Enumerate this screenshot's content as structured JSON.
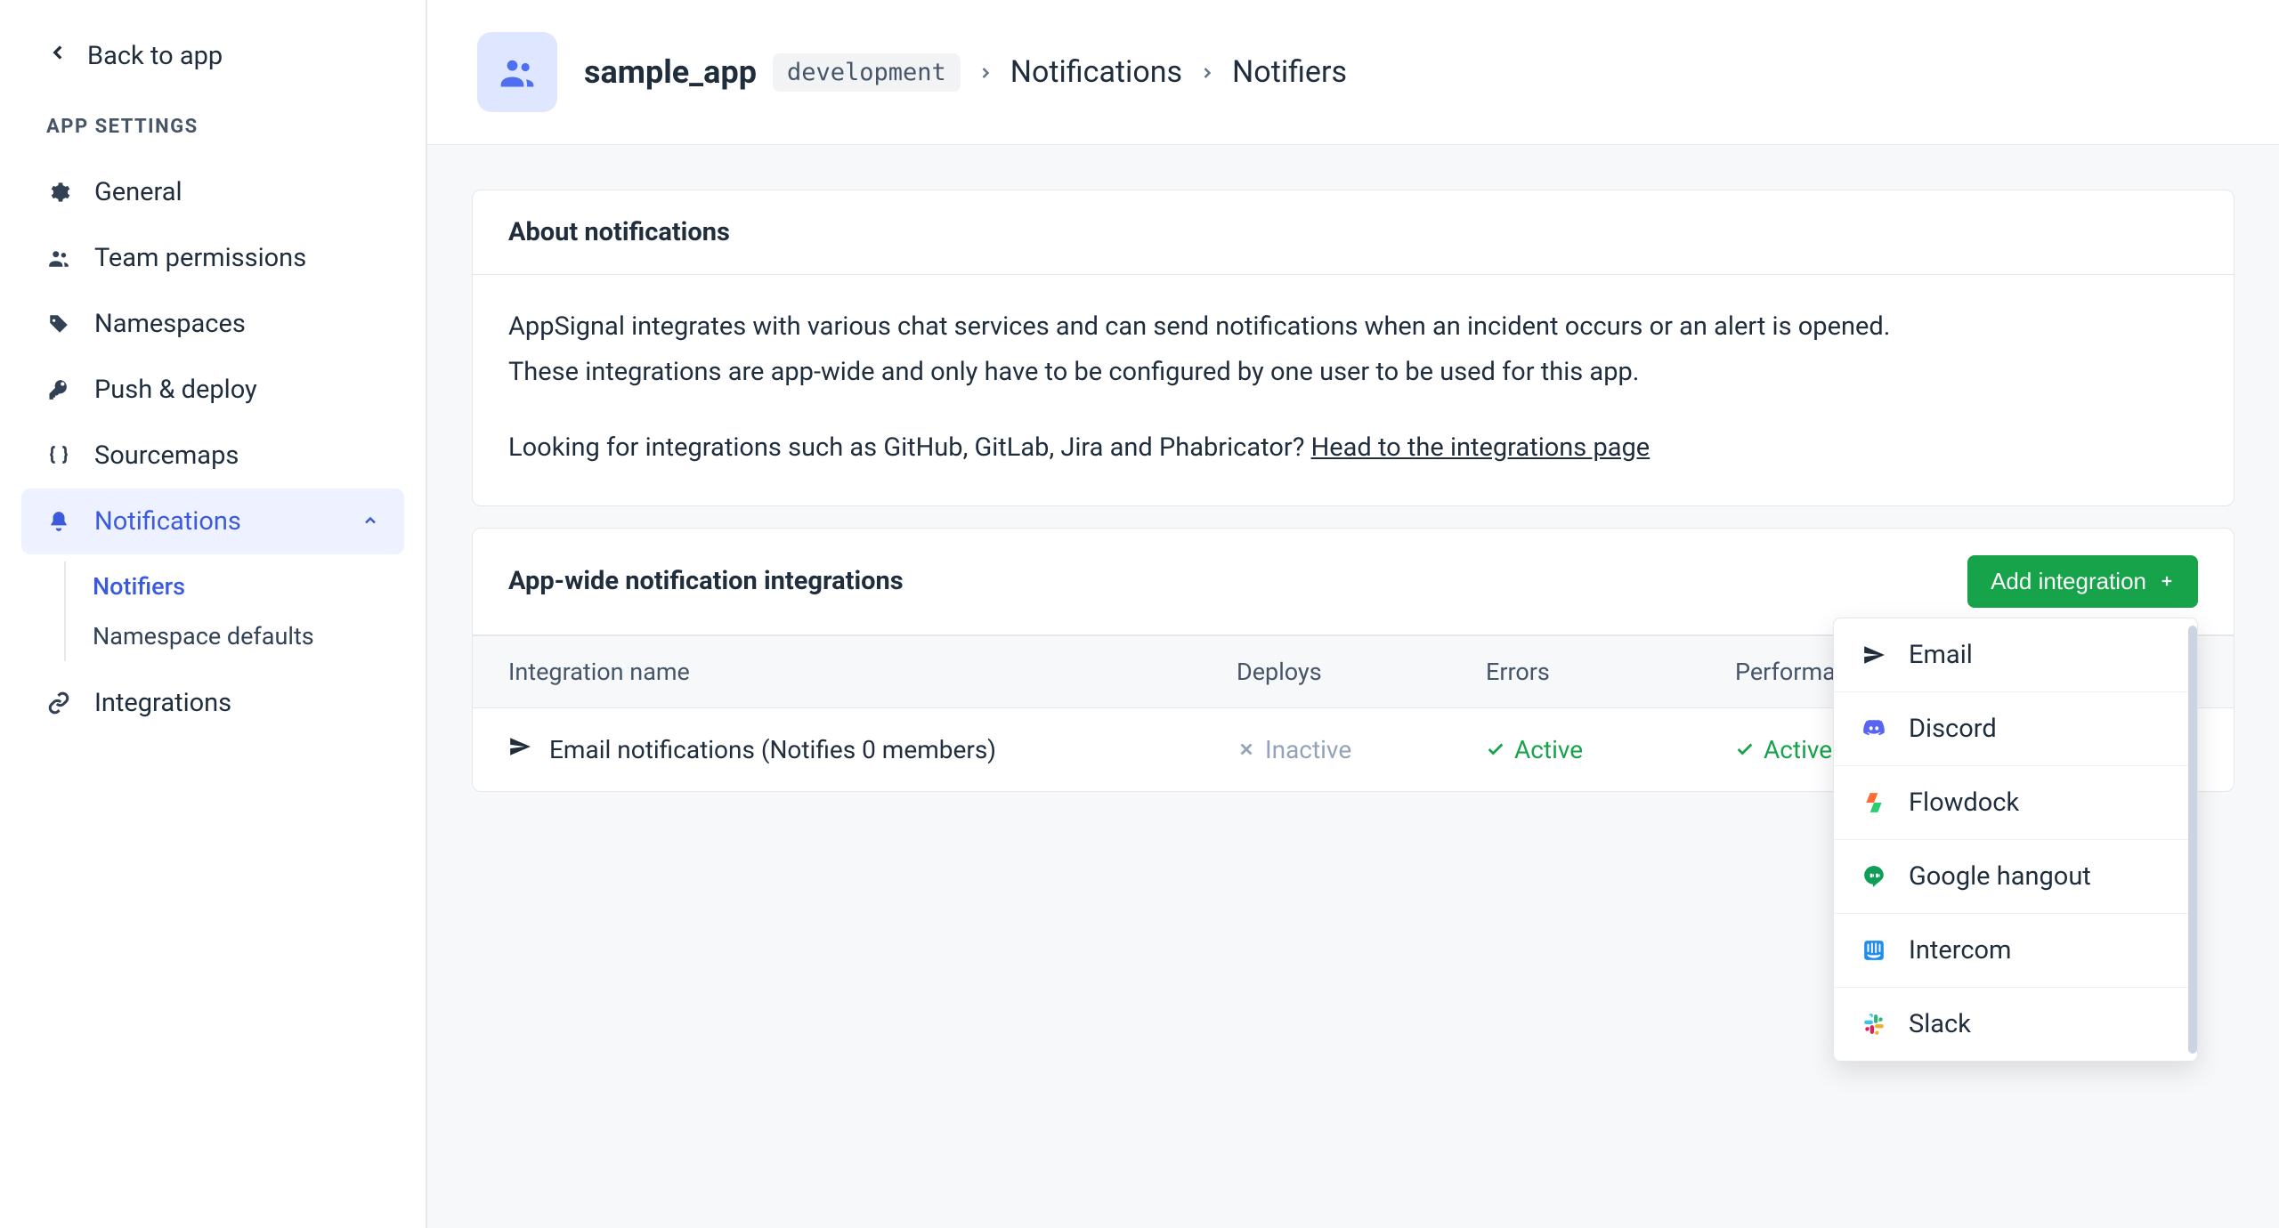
{
  "sidebar": {
    "back_label": "Back to app",
    "section_label": "APP SETTINGS",
    "items": [
      {
        "icon": "gear",
        "label": "General"
      },
      {
        "icon": "users",
        "label": "Team permissions"
      },
      {
        "icon": "tag",
        "label": "Namespaces"
      },
      {
        "icon": "key",
        "label": "Push & deploy"
      },
      {
        "icon": "braces",
        "label": "Sourcemaps"
      },
      {
        "icon": "bell",
        "label": "Notifications",
        "active": true
      },
      {
        "icon": "link",
        "label": "Integrations"
      }
    ],
    "sub_items": [
      {
        "label": "Notifiers",
        "selected": true
      },
      {
        "label": "Namespace defaults"
      }
    ]
  },
  "header": {
    "app_name": "sample_app",
    "env": "development",
    "crumbs": [
      "Notifications",
      "Notifiers"
    ]
  },
  "about": {
    "title": "About notifications",
    "line1": "AppSignal integrates with various chat services and can send notifications when an incident occurs or an alert is opened.",
    "line2": "These integrations are app-wide and only have to be configured by one user to be used for this app.",
    "line3_prefix": "Looking for integrations such as GitHub, GitLab, Jira and Phabricator? ",
    "line3_link": "Head to the integrations page"
  },
  "integrations": {
    "title": "App-wide notification integrations",
    "add_button": "Add integration",
    "columns": [
      "Integration name",
      "Deploys",
      "Errors",
      "Performance"
    ],
    "rows": [
      {
        "name": "Email notifications (Notifies 0 members)",
        "deploys": {
          "state": "inactive",
          "label": "Inactive"
        },
        "errors": {
          "state": "active",
          "label": "Active"
        },
        "performance": {
          "state": "active",
          "label": "Active"
        }
      }
    ]
  },
  "dropdown": {
    "options": [
      {
        "label": "Email",
        "icon": "paper-plane",
        "color": "#1f2d3d"
      },
      {
        "label": "Discord",
        "icon": "discord",
        "color": "#5865F2"
      },
      {
        "label": "Flowdock",
        "icon": "flowdock",
        "color": "#3cb371"
      },
      {
        "label": "Google hangout",
        "icon": "hangouts",
        "color": "#0f9d58"
      },
      {
        "label": "Intercom",
        "icon": "intercom",
        "color": "#1f8ded"
      },
      {
        "label": "Slack",
        "icon": "slack",
        "color": "#e01e5a"
      }
    ]
  }
}
